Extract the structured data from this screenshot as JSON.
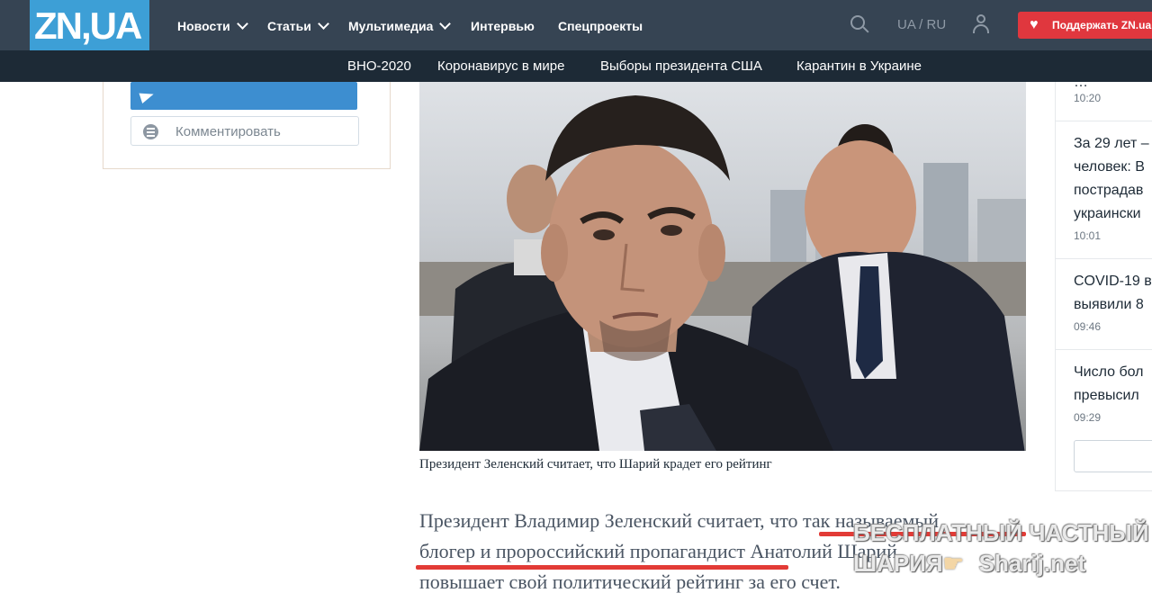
{
  "header": {
    "logo_text": "ZN,UA",
    "nav": [
      {
        "label": "Новости",
        "has_dropdown": true
      },
      {
        "label": "Статьи",
        "has_dropdown": true
      },
      {
        "label": "Мультимедиа",
        "has_dropdown": true
      },
      {
        "label": "Интервью",
        "has_dropdown": false
      },
      {
        "label": "Спецпроекты",
        "has_dropdown": false
      }
    ],
    "lang_switch": "UA / RU",
    "support_label": "Поддержать ZN.ua",
    "icons": [
      "search-icon",
      "user-icon",
      "heart-icon"
    ]
  },
  "subnav": [
    "ВНО-2020",
    "Коронавирус в мире",
    "Выборы президента США",
    "Карантин в Украине"
  ],
  "share": {
    "telegram_icon": "telegram-icon",
    "comment_label": "Комментировать"
  },
  "article": {
    "photo_caption": "Президент Зеленский считает, что Шарий крадет его рейтинг",
    "paragraph_lines": [
      "Президент Владимир Зеленский считает, что так называемый",
      "блогер и пророссийский пропагандист Анатолий Шарий",
      "повышает свой политический рейтинг за его счет."
    ]
  },
  "watermark": {
    "line1": "БЕСПЛАТНЫЙ ЧАСТНЫЙ",
    "line2_left": "ШАРИЯ",
    "line2_right": "Sharij.net"
  },
  "news_feed": [
    {
      "title": "…",
      "time": "10:20"
    },
    {
      "title": "За 29 лет –\nчеловек: В\nпострадав\nукраински",
      "time": "10:01"
    },
    {
      "title": "COVID-19 в\nвыявили 8",
      "time": "09:46"
    },
    {
      "title": "Число бол\nпревысил",
      "time": "09:29"
    }
  ],
  "colors": {
    "topbar": "#364453",
    "subbar": "#1d2a36",
    "logo": "#3d9fd6",
    "support": "#e0373e",
    "telegram": "#3d8ed0",
    "underline": "#e23b36"
  }
}
